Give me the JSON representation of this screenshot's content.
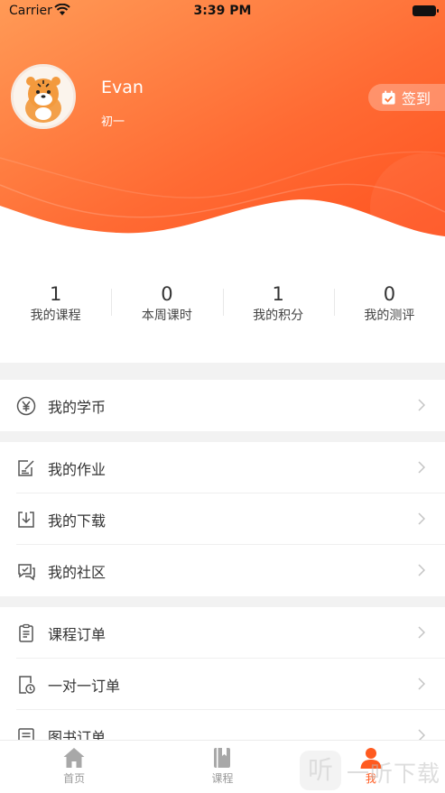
{
  "status_bar": {
    "carrier": "Carrier",
    "time": "3:39 PM"
  },
  "profile": {
    "name": "Evan",
    "grade": "初一",
    "checkin_label": "签到"
  },
  "stats": [
    {
      "value": "1",
      "label": "我的课程"
    },
    {
      "value": "0",
      "label": "本周课时"
    },
    {
      "value": "1",
      "label": "我的积分"
    },
    {
      "value": "0",
      "label": "我的测评"
    }
  ],
  "menu": {
    "coins": "我的学币",
    "homework": "我的作业",
    "downloads": "我的下载",
    "community": "我的社区",
    "course_orders": "课程订单",
    "one_on_one_orders": "一对一订单",
    "book_orders": "图书订单"
  },
  "tabbar": {
    "home": "首页",
    "courses": "课程",
    "me": "我"
  },
  "watermark": {
    "glyph": "听",
    "text": "一听下载"
  },
  "colors": {
    "accent": "#ff5a1f",
    "header_start": "#ff8a4a",
    "header_end": "#ff5a22"
  },
  "icons": [
    "wifi-icon",
    "battery-icon",
    "avatar-tiger",
    "calendar-check-icon",
    "yen-coin-icon",
    "edit-note-icon",
    "download-icon",
    "chat-icon",
    "clipboard-icon",
    "clock-doc-icon",
    "book-list-icon",
    "chevron-right-icon",
    "home-icon",
    "book-icon",
    "person-icon"
  ]
}
